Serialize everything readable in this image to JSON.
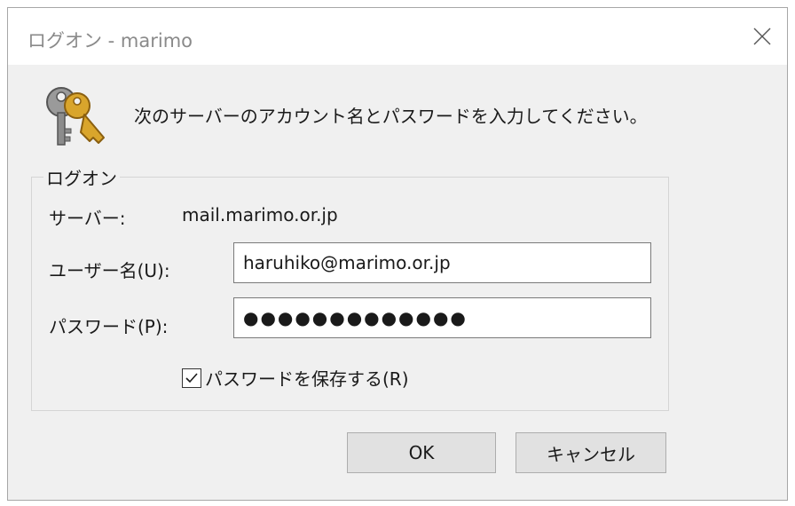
{
  "window": {
    "title": "ログオン - marimo",
    "close_icon": "close-icon"
  },
  "prompt": {
    "icon": "key-icon",
    "text": "次のサーバーのアカウント名とパスワードを入力してください。"
  },
  "logon_group": {
    "label": "ログオン",
    "server_label": "サーバー:",
    "server_value": "mail.marimo.or.jp",
    "username_label": "ユーザー名(U):",
    "username_value": "haruhiko@marimo.or.jp",
    "password_label": "パスワード(P):",
    "password_display": "●●●●●●●●●●●●●",
    "remember_checked": true,
    "remember_label": "パスワードを保存する(R)"
  },
  "buttons": {
    "ok_label": "OK",
    "cancel_label": "キャンセル"
  },
  "colors": {
    "dialog_background": "#f0f0f0",
    "title_text": "#8a8a8a",
    "button_background": "#e1e1e1"
  }
}
